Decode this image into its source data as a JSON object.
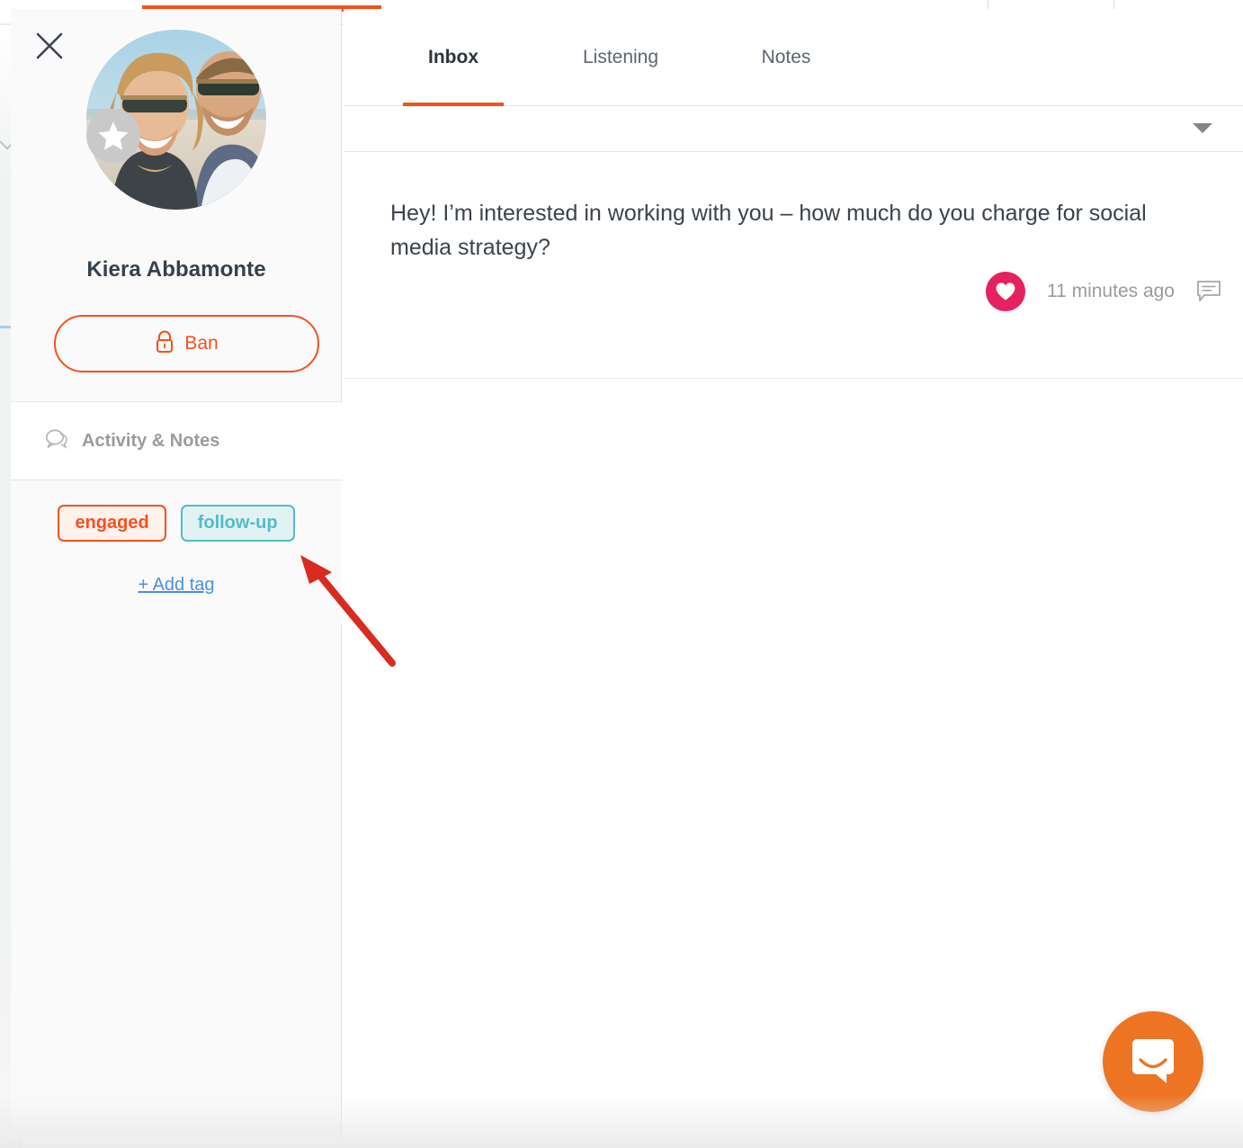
{
  "profile": {
    "close_icon": "close-icon",
    "avatar_alt": "profile-photo-couple-beach",
    "star_badge_icon": "star-icon",
    "name": "Kiera Abbamonte",
    "ban_button_label": "Ban",
    "ban_icon": "lock-icon"
  },
  "activity": {
    "icon": "speech-bubble-icon",
    "label": "Activity & Notes"
  },
  "tags": {
    "items": [
      {
        "label": "engaged",
        "color": "#f4511e",
        "background": "#fff1ec"
      },
      {
        "label": "follow-up",
        "color": "#53bcc9",
        "background": "#e2f2f3"
      }
    ],
    "add_tag_label": "+ Add tag",
    "add_tag_color": "#4a90e2"
  },
  "tabs": [
    {
      "label": "Inbox",
      "active": true
    },
    {
      "label": "Listening",
      "active": false
    },
    {
      "label": "Notes",
      "active": false
    }
  ],
  "filter_bar": {
    "chevron_icon": "chevron-down-icon"
  },
  "message": {
    "body": "Hey! I’m interested in working with you – how much do you charge for social media strategy?",
    "like_icon": "heart-icon",
    "like_color": "#e5225f",
    "timestamp": "11 minutes ago",
    "reply_icon": "comment-icon"
  },
  "annotation": {
    "arrow": "red-arrow-pointing-to-tags",
    "color": "#d92b1f"
  },
  "intercom": {
    "icon": "intercom-chat-icon",
    "color": "#ed7422"
  },
  "theme": {
    "accent": "#f2521b",
    "tab_active_underline": "#f2521b"
  }
}
